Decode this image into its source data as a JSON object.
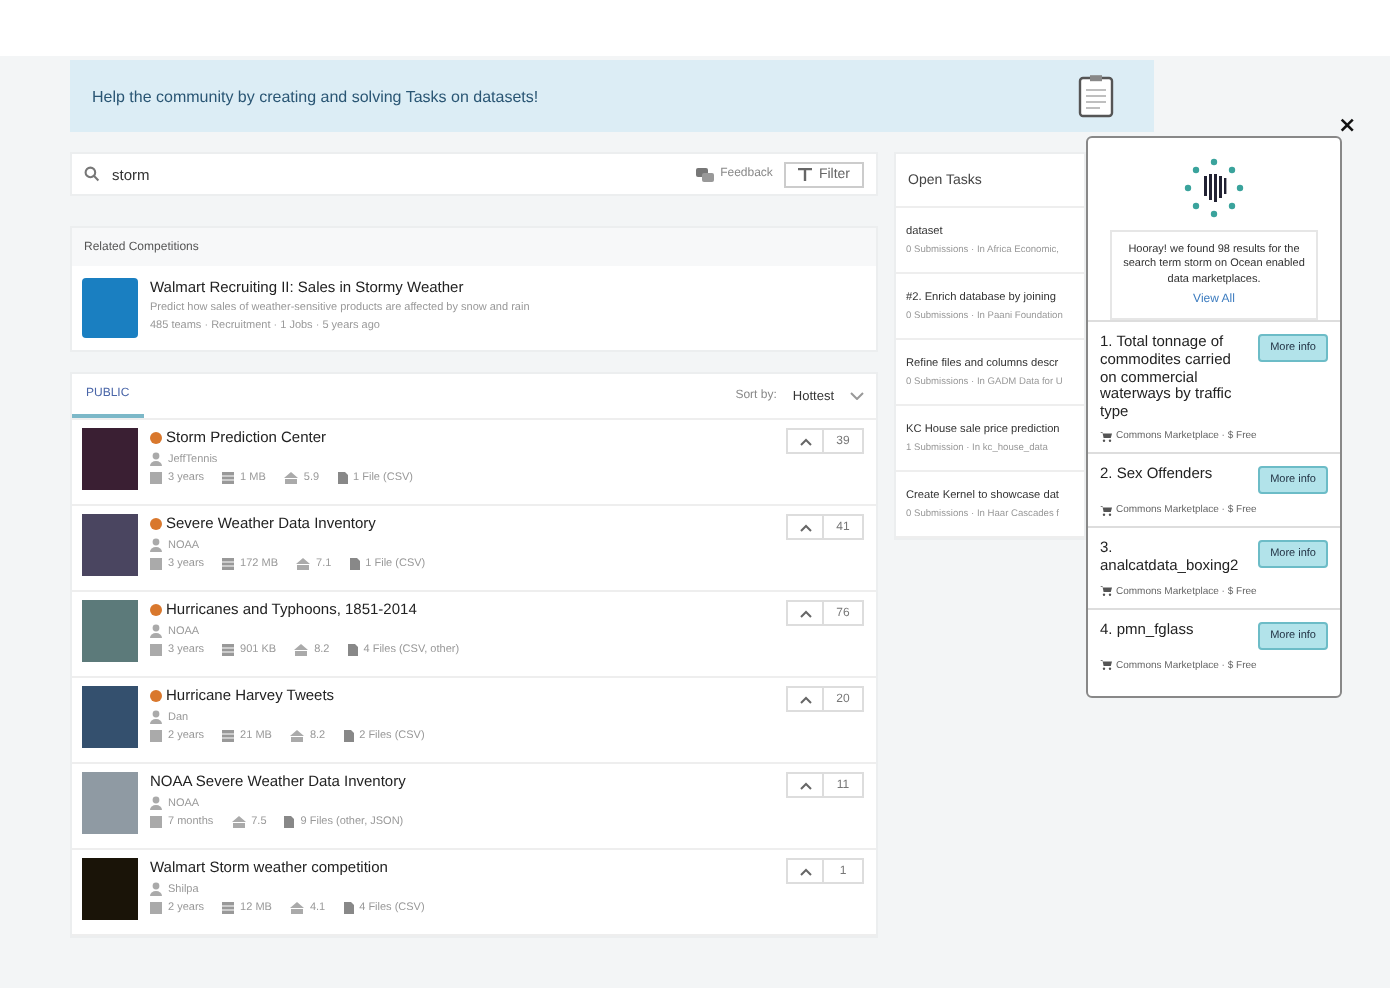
{
  "banner": {
    "text": "Help the community by creating and solving Tasks on datasets!"
  },
  "search": {
    "value": "storm",
    "feedback": "Feedback",
    "filter": "Filter"
  },
  "related": {
    "heading": "Related Competitions",
    "items": [
      {
        "title": "Walmart Recruiting II: Sales in Stormy Weather",
        "description": "Predict how sales of weather-sensitive products are affected by snow and rain",
        "meta": "485 teams · Recruitment · 1 Jobs · 5 years ago",
        "color": "#1a7fc1"
      }
    ]
  },
  "datasets": {
    "tabs": [
      {
        "label": "PUBLIC",
        "selected": true
      }
    ],
    "sort_label": "Sort by:",
    "sort_value": "Hottest",
    "items": [
      {
        "title": "Storm Prediction Center",
        "medal": true,
        "owner": "JeffTennis",
        "age": "3 years",
        "size": "1 MB",
        "usability": "5.9",
        "files": "1 File (CSV)",
        "votes": "39",
        "color": "#3a1f33"
      },
      {
        "title": "Severe Weather Data Inventory",
        "medal": true,
        "owner": "NOAA",
        "age": "3 years",
        "size": "172 MB",
        "usability": "7.1",
        "files": "1 File (CSV)",
        "votes": "41",
        "color": "#4a4560"
      },
      {
        "title": "Hurricanes and Typhoons, 1851-2014",
        "medal": true,
        "owner": "NOAA",
        "age": "3 years",
        "size": "901 KB",
        "usability": "8.2",
        "files": "4 Files (CSV, other)",
        "votes": "76",
        "color": "#5c7a7a"
      },
      {
        "title": "Hurricane Harvey Tweets",
        "medal": true,
        "owner": "Dan",
        "age": "2 years",
        "size": "21 MB",
        "usability": "8.2",
        "files": "2 Files (CSV)",
        "votes": "20",
        "color": "#34506e"
      },
      {
        "title": "NOAA Severe Weather Data Inventory",
        "medal": false,
        "owner": "NOAA",
        "age": "7 months",
        "usability": "7.5",
        "files": "9 Files (other, JSON)",
        "votes": "11",
        "color": "#8f9aa3"
      },
      {
        "title": "Walmart Storm weather competition",
        "medal": false,
        "owner": "Shilpa",
        "age": "2 years",
        "size": "12 MB",
        "usability": "4.1",
        "files": "4 Files (CSV)",
        "votes": "1",
        "color": "#1a1408"
      }
    ]
  },
  "open_tasks": {
    "heading": "Open Tasks",
    "items": [
      {
        "title": "dataset",
        "meta": "0 Submissions · In Africa Economic,"
      },
      {
        "title": "#2. Enrich database by joining",
        "meta": "0 Submissions · In Paani Foundation"
      },
      {
        "title": "Refine files and columns descr",
        "meta": "0 Submissions · In GADM Data for U"
      },
      {
        "title": "KC House sale price prediction",
        "meta": "1 Submission · In kc_house_data"
      },
      {
        "title": "Create Kernel to showcase dat",
        "meta": "0 Submissions · In Haar Cascades f"
      }
    ]
  },
  "popup": {
    "close": "×",
    "message": "Hooray! we found 98 results for the search term storm on Ocean enabled data marketplaces.",
    "link": "View All",
    "results": [
      {
        "title": "1. Total tonnage of commodites carried on commercial waterways by traffic type",
        "meta": "Commons Marketplace · $ Free",
        "button": "More info"
      },
      {
        "title": "2. Sex Offenders",
        "meta": "Commons Marketplace · $ Free",
        "button": "More info"
      },
      {
        "title": "3. analcatdata_boxing2",
        "meta": "Commons Marketplace · $ Free",
        "button": "More info"
      },
      {
        "title": "4. pmn_fglass",
        "meta": "Commons Marketplace · $ Free",
        "button": "More info"
      }
    ]
  }
}
